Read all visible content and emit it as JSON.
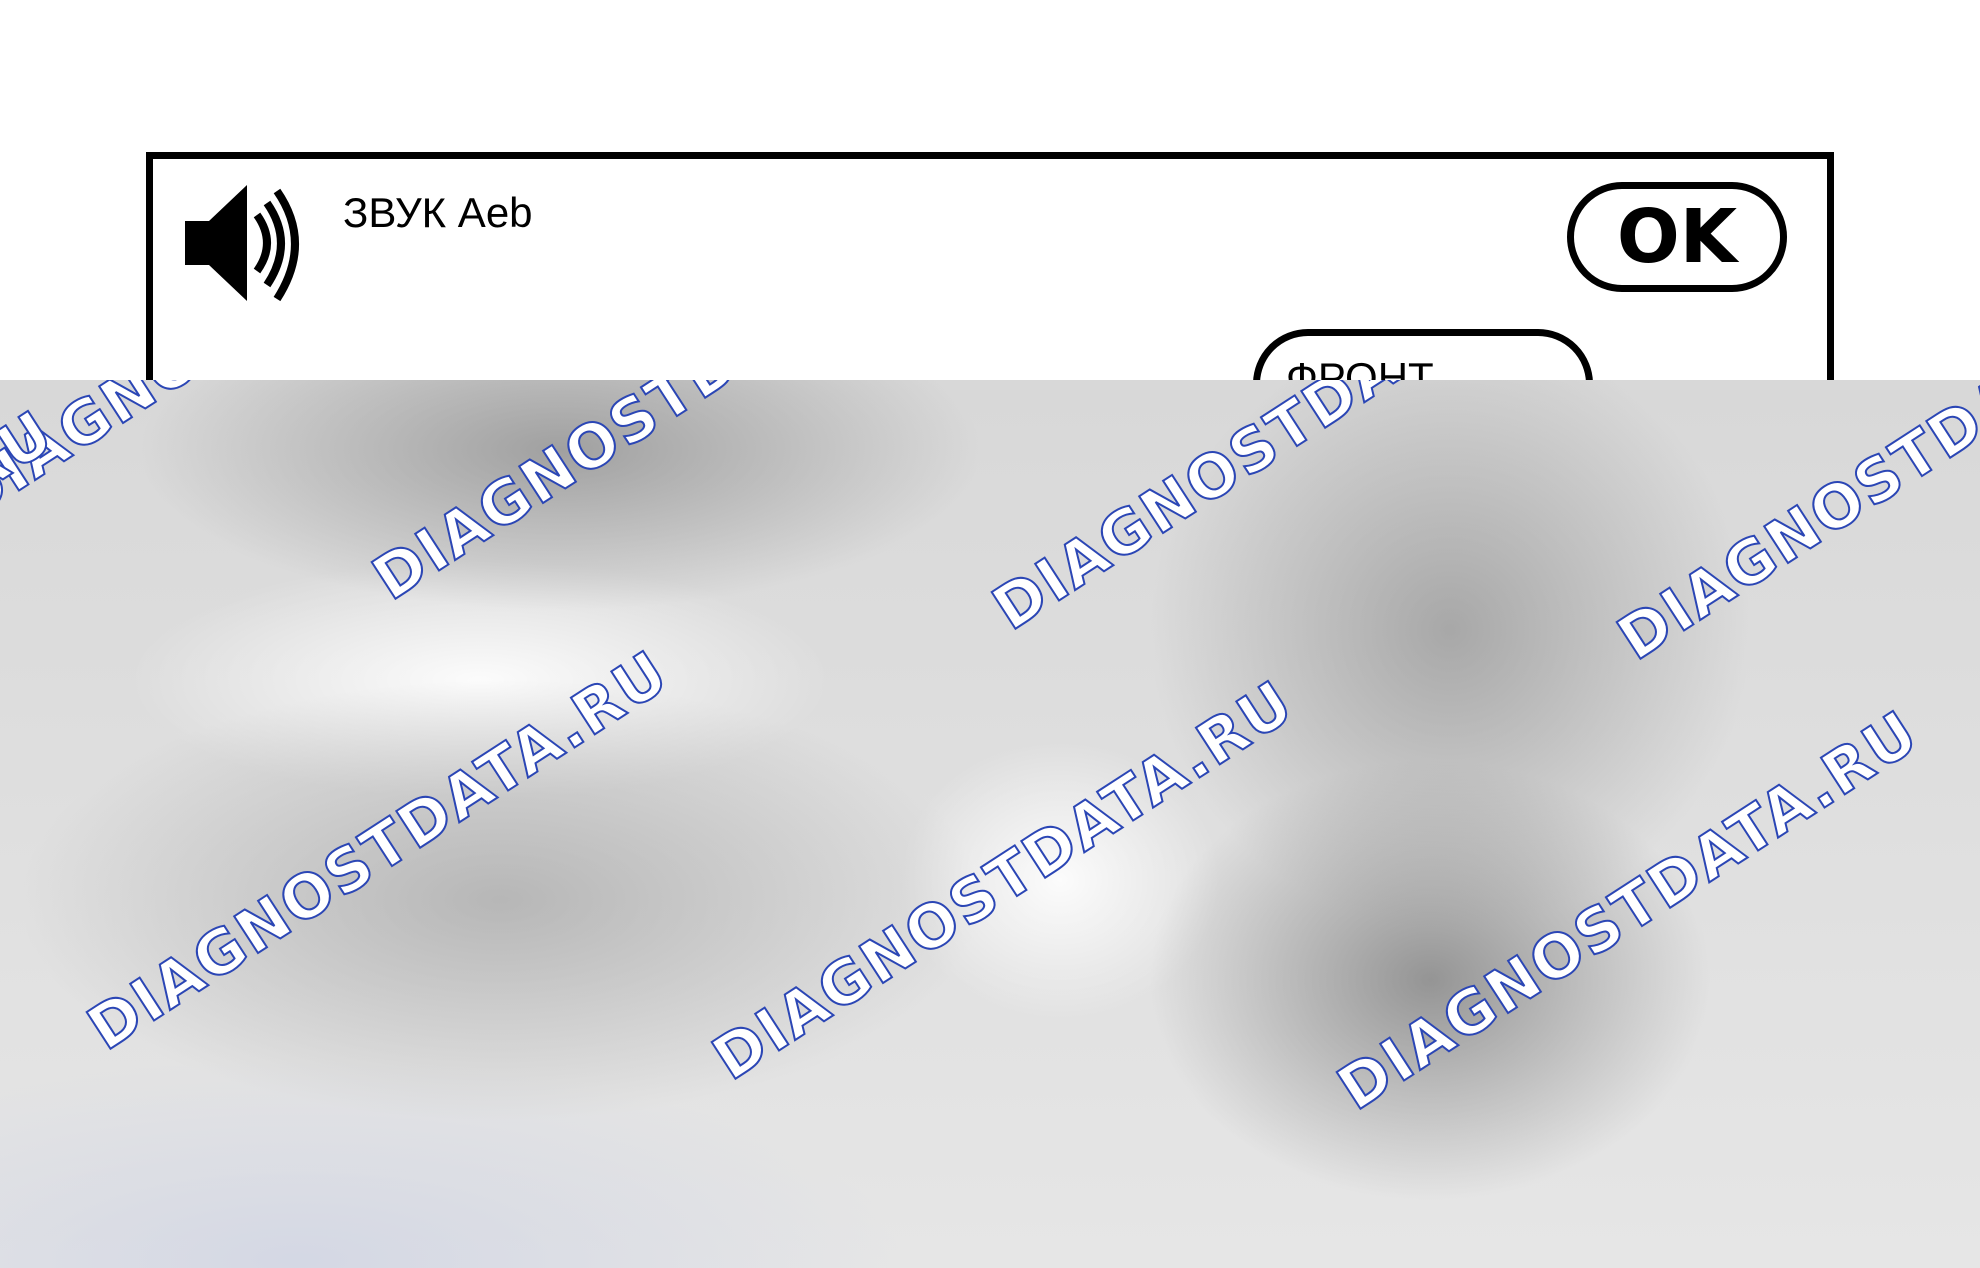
{
  "screen": {
    "title": "ЗВУК Aeb",
    "ok_label": "OK",
    "front_label": "ФРОНТ"
  },
  "icons": {
    "speaker": "speaker-volume-icon"
  },
  "watermark": {
    "text": "DIAGNOSTDATA.RU",
    "color": "#2b46b5"
  }
}
